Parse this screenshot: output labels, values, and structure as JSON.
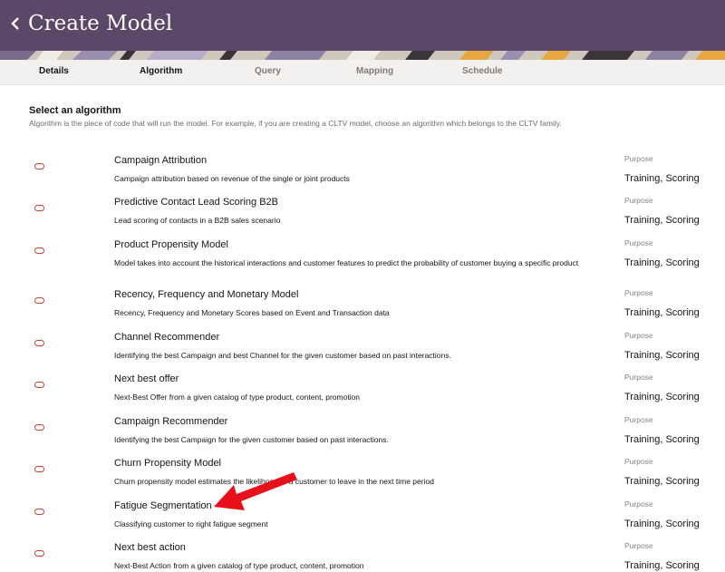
{
  "header": {
    "title": "Create Model",
    "back_icon": "chevron-left-icon"
  },
  "tabs": [
    {
      "label": "Details",
      "state": "done"
    },
    {
      "label": "Algorithm",
      "state": "active"
    },
    {
      "label": "Query",
      "state": "pending"
    },
    {
      "label": "Mapping",
      "state": "pending"
    },
    {
      "label": "Schedule",
      "state": "pending"
    }
  ],
  "section": {
    "title": "Select an algorithm",
    "description": "Algorithm is the piece of code that will run the model. For example, if you are creating a CLTV model, choose an algorithm which belongs to the CLTV family."
  },
  "algorithms": [
    {
      "name": "Campaign Attribution",
      "description": "Campaign attribution based on revenue of the single or joint products",
      "purpose_label": "Purpose",
      "purpose": "Training, Scoring"
    },
    {
      "name": "Predictive Contact Lead Scoring B2B",
      "description": "Lead scoring of contacts in a B2B sales scenario",
      "purpose_label": "Purpose",
      "purpose": "Training, Scoring"
    },
    {
      "name": "Product Propensity Model",
      "description": "Model takes into account the historical interactions and customer features to predict the probability of customer buying a specific product",
      "purpose_label": "Purpose",
      "purpose": "Training, Scoring"
    },
    {
      "name": "Recency, Frequency and Monetary Model",
      "description": "Recency, Frequency and Monetary Scores based on Event and Transaction data",
      "purpose_label": "Purpose",
      "purpose": "Training, Scoring"
    },
    {
      "name": "Channel Recommender",
      "description": "Identifying the best Campaign and best Channel for the given customer based on past interactions.",
      "purpose_label": "Purpose",
      "purpose": "Training, Scoring"
    },
    {
      "name": "Next best offer",
      "description": "Next-Best Offer from a given catalog of type product, content, promotion",
      "purpose_label": "Purpose",
      "purpose": "Training, Scoring"
    },
    {
      "name": "Campaign Recommender",
      "description": "Identifying the best Campaign for the given customer based on past interactions.",
      "purpose_label": "Purpose",
      "purpose": "Training, Scoring"
    },
    {
      "name": "Churn Propensity Model",
      "description": "Churn propensity model estimates the likelihood of a customer to leave in the next time period",
      "purpose_label": "Purpose",
      "purpose": "Training, Scoring"
    },
    {
      "name": "Fatigue Segmentation",
      "description": "Classifying customer to right fatigue segment",
      "purpose_label": "Purpose",
      "purpose": "Training, Scoring"
    },
    {
      "name": "Next best action",
      "description": "Next-Best Action from a given catalog of type product, content, promotion",
      "purpose_label": "Purpose",
      "purpose": "Training, Scoring"
    }
  ],
  "colors": {
    "header_bg": "#5b4767",
    "radio": "#c74634",
    "arrow": "#e8111b"
  }
}
